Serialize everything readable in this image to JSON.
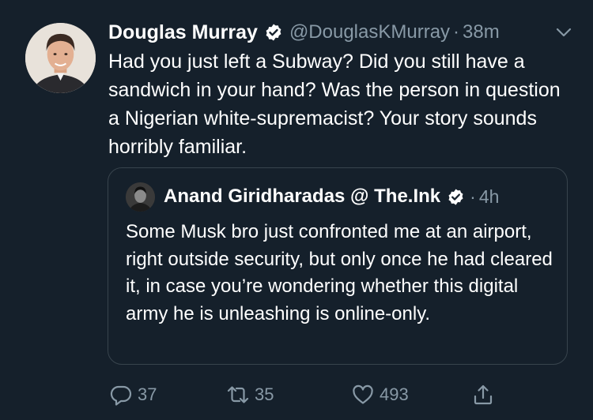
{
  "tweet": {
    "author_name": "Douglas Murray",
    "handle": "@DouglasKMurray",
    "separator": "·",
    "time": "38m",
    "text": "Had you just left a Subway? Did you still have a sandwich in your hand? Was the person in question a Nigerian white-supremacist? Your story sounds horribly familiar."
  },
  "quoted": {
    "author_name": "Anand Giridharadas @ The.Ink",
    "separator": "·",
    "time": "4h",
    "text": "Some Musk bro just confronted me at an airport, right outside security, but only once he had cleared it, in case you’re wondering whether this digital army he is unleashing is online-only."
  },
  "actions": {
    "replies": "37",
    "retweets": "35",
    "likes": "493"
  },
  "icons": {
    "verified": "verified-badge-icon",
    "caret": "chevron-down-icon",
    "reply": "reply-icon",
    "retweet": "retweet-icon",
    "like": "heart-icon",
    "share": "share-icon"
  },
  "colors": {
    "background": "#15202b",
    "text_primary": "#ffffff",
    "text_secondary": "#8899a6",
    "border": "#38444d"
  }
}
